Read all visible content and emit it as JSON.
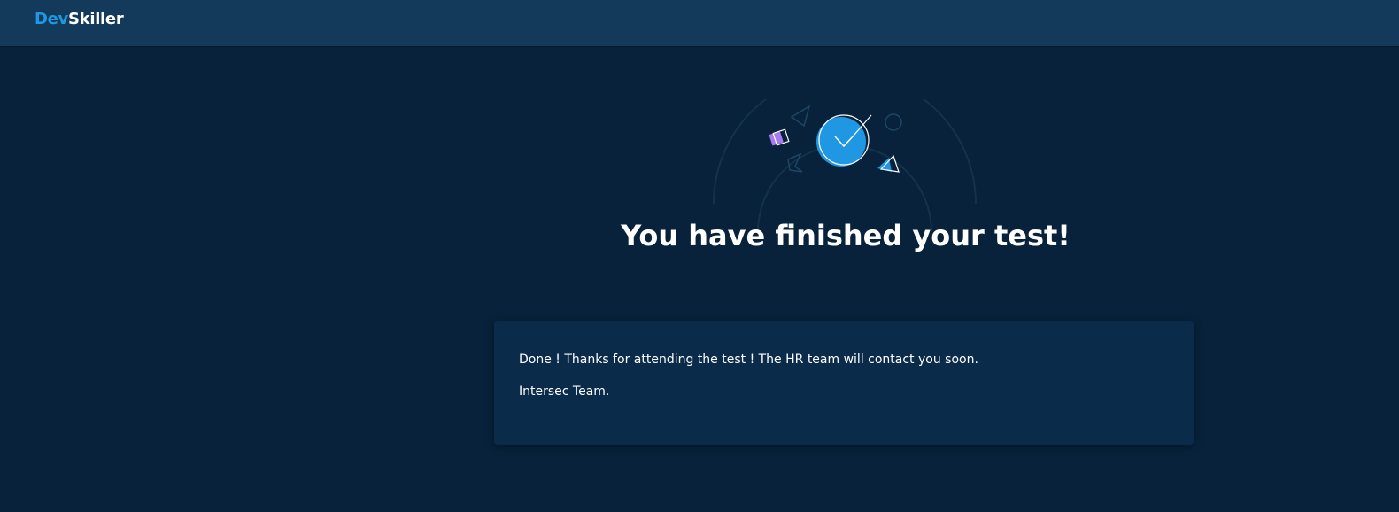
{
  "header": {
    "logo_part1": "Dev",
    "logo_part2": "Skiller"
  },
  "hero": {
    "icon": "check-clock-icon",
    "title": "You have finished your test!"
  },
  "message": {
    "line1": "Done ! Thanks for attending the test ! The HR team will contact you soon.",
    "line2": "Intersec Team."
  },
  "colors": {
    "background": "#07223a",
    "topbar": "#143a5b",
    "card": "#0a2b4a",
    "accent": "#1f97e3",
    "purple": "#a77bf0"
  }
}
